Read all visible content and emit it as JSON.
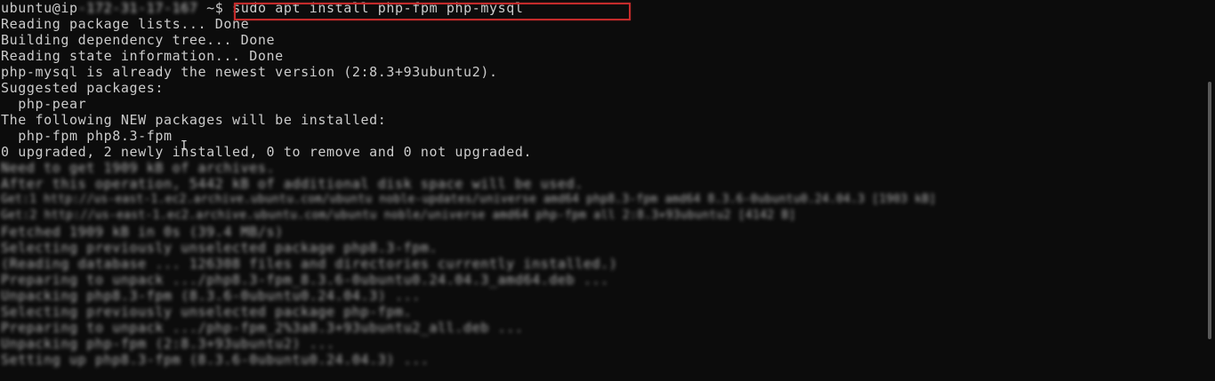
{
  "terminal": {
    "prompt_user": "ubuntu@ip",
    "prompt_host_redacted": "-172-31-17-167",
    "prompt_suffix": " ~$ ",
    "command": "sudo apt install php-fpm php-mysql",
    "output": [
      "Reading package lists... Done",
      "Building dependency tree... Done",
      "Reading state information... Done",
      "php-mysql is already the newest version (2:8.3+93ubuntu2).",
      "Suggested packages:",
      "  php-pear",
      "The following NEW packages will be installed:",
      "  php-fpm php8.3-fpm",
      "0 upgraded, 2 newly installed, 0 to remove and 0 not upgraded."
    ],
    "blurred_output": [
      "Need to get 1909 kB of archives.",
      "After this operation, 5442 kB of additional disk space will be used.",
      "Get:1 http://us-east-1.ec2.archive.ubuntu.com/ubuntu noble-updates/universe amd64 php8.3-fpm amd64 8.3.6-0ubuntu0.24.04.3 [1903 kB]",
      "Get:2 http://us-east-1.ec2.archive.ubuntu.com/ubuntu noble/universe amd64 php-fpm all 2:8.3+93ubuntu2 [4142 B]",
      "Fetched 1909 kB in 0s (39.4 MB/s)",
      "Selecting previously unselected package php8.3-fpm.",
      "(Reading database ... 126308 files and directories currently installed.)",
      "Preparing to unpack .../php8.3-fpm_8.3.6-0ubuntu0.24.04.3_amd64.deb ...",
      "Unpacking php8.3-fpm (8.3.6-0ubuntu0.24.04.3) ...",
      "Selecting previously unselected package php-fpm.",
      "Preparing to unpack .../php-fpm_2%3a8.3+93ubuntu2_all.deb ...",
      "Unpacking php-fpm (2:8.3+93ubuntu2) ...",
      "Setting up php8.3-fpm (8.3.6-0ubuntu0.24.04.3) ..."
    ],
    "colors": {
      "background": "#0c0c0c",
      "foreground": "#cccccc",
      "highlight_border": "#c42b2b"
    }
  }
}
